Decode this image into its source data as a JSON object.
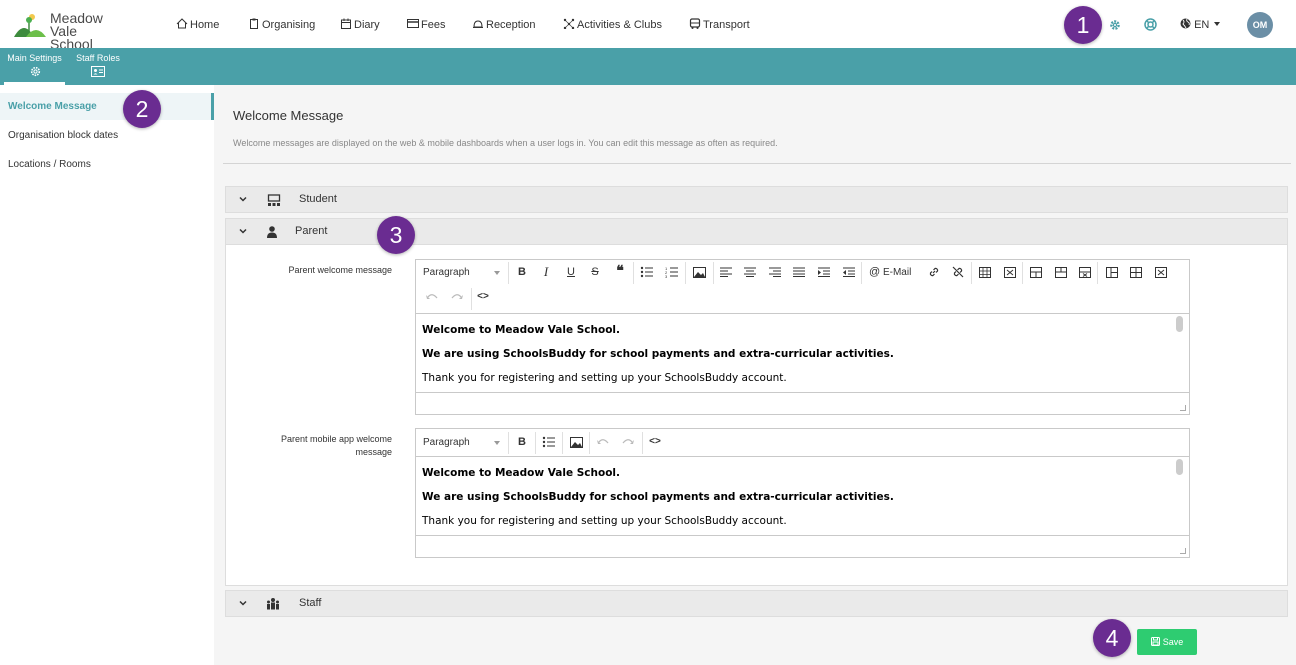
{
  "brand": {
    "line1": "Meadow",
    "line2": "Vale School"
  },
  "nav": [
    {
      "label": "Home",
      "icon": "home-icon"
    },
    {
      "label": "Organising",
      "icon": "clipboard-icon"
    },
    {
      "label": "Diary",
      "icon": "calendar-icon"
    },
    {
      "label": "Fees",
      "icon": "card-icon"
    },
    {
      "label": "Reception",
      "icon": "bell-icon"
    },
    {
      "label": "Activities & Clubs",
      "icon": "network-icon"
    },
    {
      "label": "Transport",
      "icon": "bus-icon"
    }
  ],
  "header": {
    "language": "EN",
    "avatar_initials": "OM"
  },
  "subtabs": [
    {
      "label": "Main Settings"
    },
    {
      "label": "Staff Roles"
    }
  ],
  "sidebar": {
    "items": [
      {
        "label": "Welcome Message"
      },
      {
        "label": "Organisation block dates"
      },
      {
        "label": "Locations / Rooms"
      }
    ]
  },
  "page": {
    "title": "Welcome Message",
    "description": "Welcome messages are displayed on the web & mobile dashboards when a user logs in. You can edit this message as often as required."
  },
  "panels": {
    "student": "Student",
    "parent": "Parent",
    "staff": "Staff"
  },
  "fields": {
    "web_label": "Parent welcome message",
    "app_label_1": "Parent mobile app welcome",
    "app_label_2": "message"
  },
  "editor": {
    "format": "Paragraph",
    "email_label": "E-Mail",
    "line1": "Welcome to Meadow Vale School.",
    "line2": "We are using SchoolsBuddy for school payments and extra-curricular activities.",
    "line3": "Thank you for registering and setting up your SchoolsBuddy account."
  },
  "save_label": "Save",
  "badges": [
    "1",
    "2",
    "3",
    "4"
  ],
  "colors": {
    "teal": "#4aa0a8",
    "purple": "#6a2c91",
    "save_green": "#2ecc71",
    "avatar": "#6b8fa6"
  }
}
